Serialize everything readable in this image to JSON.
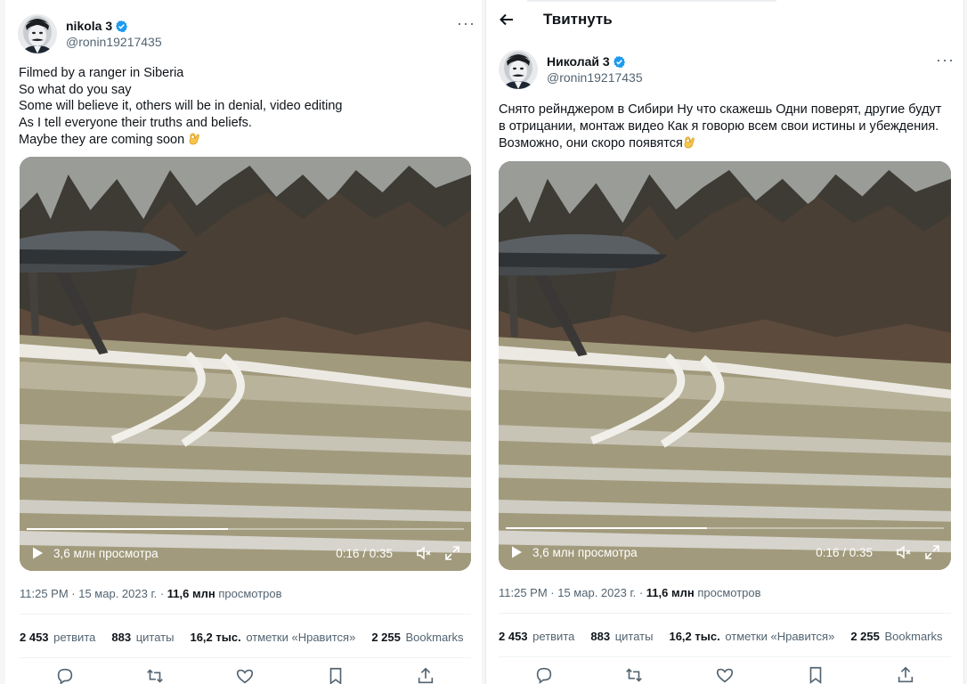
{
  "left": {
    "user": {
      "name": "nikola 3",
      "handle": "@ronin19217435"
    },
    "text": "Filmed by a ranger in Siberia\n So what do you say\n Some will believe it, others will be in denial, video editing\n As I tell everyone their truths and beliefs.\n Maybe they are coming soon",
    "video": {
      "views": "3,6 млн просмотра",
      "time": "0:16 / 0:35",
      "progress": 0.46
    },
    "timestamp": "11:25 PM · 15 мар. 2023 г. · ",
    "views_count": "11,6 млн",
    "views_label": " просмотров",
    "stats": [
      {
        "value": "2 453",
        "label": "ретвита"
      },
      {
        "value": "883",
        "label": "цитаты"
      },
      {
        "value": "16,2 тыс.",
        "label": "отметки «Нравится»"
      },
      {
        "value": "2 255",
        "label": "Bookmarks"
      }
    ]
  },
  "right": {
    "header_title": "Твитнуть",
    "user": {
      "name": "Николай 3",
      "handle": "@ronin19217435"
    },
    "text": "Снято рейнджером в Сибири Ну что скажешь Одни поверят, другие будут в отрицании, монтаж видео Как я говорю всем свои истины и убеждения. Возможно, они скоро появятся",
    "video": {
      "views": "3,6 млн просмотра",
      "time": "0:16 / 0:35",
      "progress": 0.46
    },
    "timestamp": "11:25 PM · 15 мар. 2023 г. · ",
    "views_count": "11,6 млн",
    "views_label": " просмотров",
    "stats": [
      {
        "value": "2 453",
        "label": "ретвита"
      },
      {
        "value": "883",
        "label": "цитаты"
      },
      {
        "value": "16,2 тыс.",
        "label": "отметки «Нравится»"
      },
      {
        "value": "2 255",
        "label": "Bookmarks"
      }
    ]
  },
  "icons": {
    "verified": "verified-badge-icon",
    "more": "more-options-icon",
    "back": "back-arrow-icon",
    "play": "play-icon",
    "mute": "mute-icon",
    "fullscreen": "fullscreen-icon",
    "reply": "reply-icon",
    "retweet": "retweet-icon",
    "like": "like-icon",
    "bookmark": "bookmark-icon",
    "share": "share-icon",
    "emoji": "ok-hand-emoji"
  },
  "colors": {
    "verified": "#1d9bf0",
    "muted_text": "#536471",
    "text": "#0f1419"
  }
}
